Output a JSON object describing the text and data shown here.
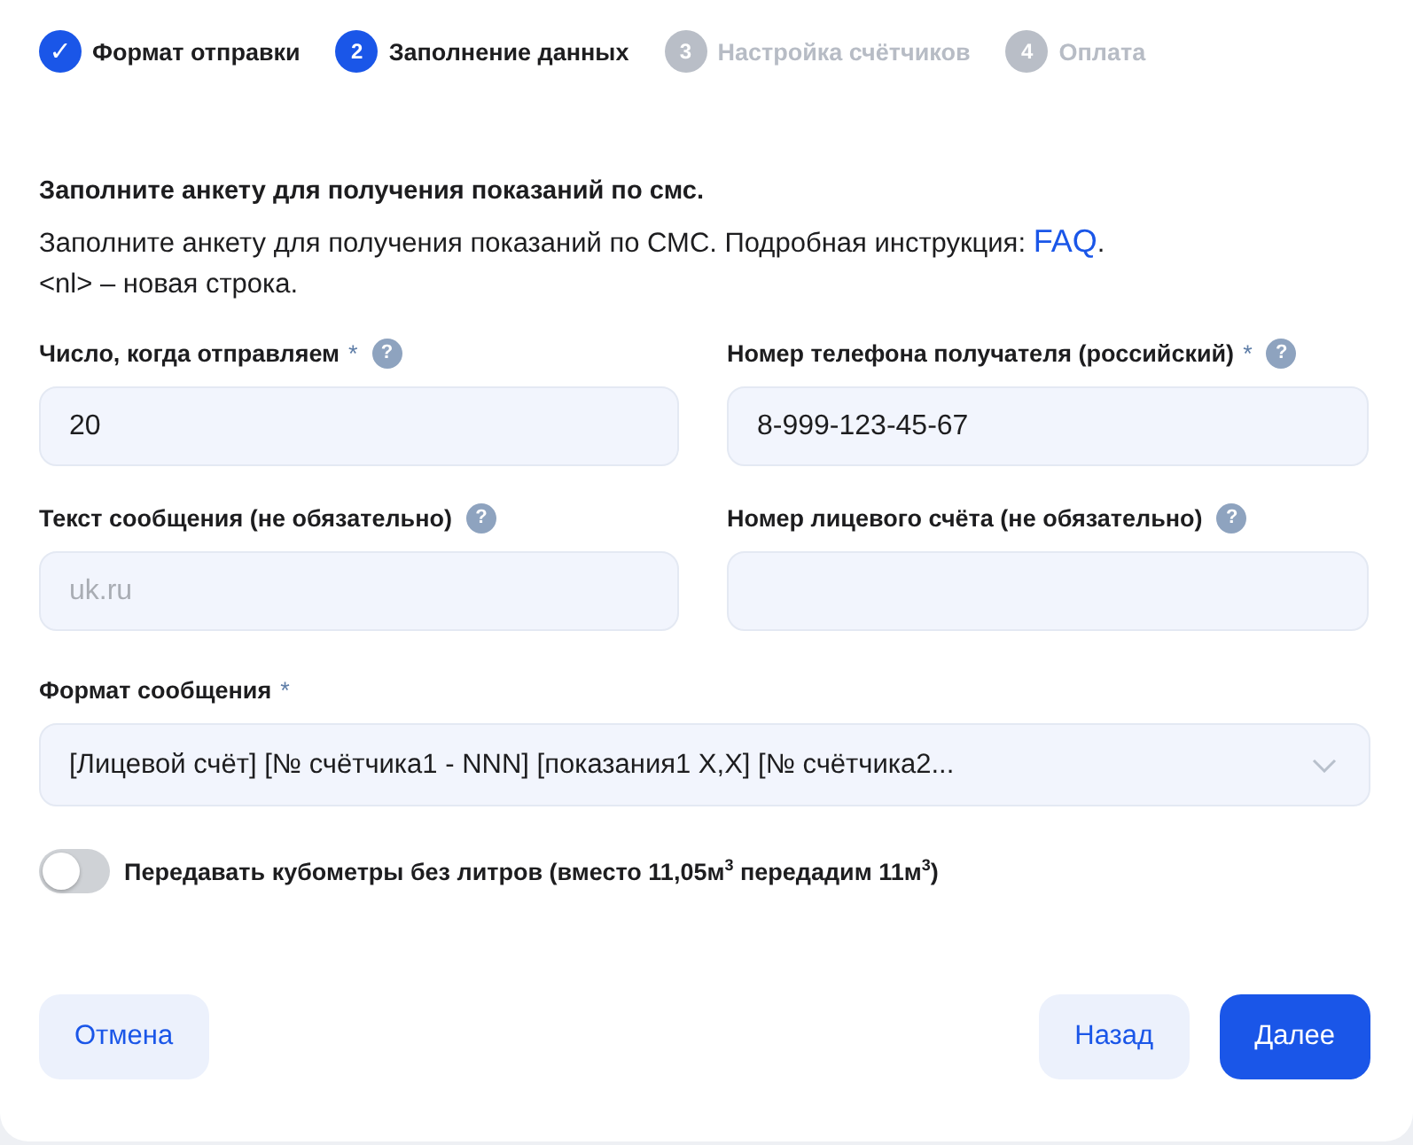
{
  "steps": [
    {
      "marker": "✓",
      "label": "Формат отправки",
      "kind": "done"
    },
    {
      "marker": "2",
      "label": "Заполнение данных",
      "kind": "current"
    },
    {
      "marker": "3",
      "label": "Настройка счётчиков",
      "kind": "upcoming"
    },
    {
      "marker": "4",
      "label": "Оплата",
      "kind": "upcoming"
    }
  ],
  "heading": "Заполните анкету для получения показаний по смс.",
  "description": {
    "before": "Заполните анкету для получения показаний по СМС. Подробная инструкция: ",
    "link": "FAQ",
    "after": ".",
    "second_line": "<nl> – новая строка."
  },
  "fields": [
    {
      "label": "Число, когда отправляем",
      "required_mark": "*",
      "help": "?",
      "value": "20"
    },
    {
      "label": "Номер телефона получателя (российский)",
      "required_mark": "*",
      "help": "?",
      "value": "8-999-123-45-67"
    },
    {
      "label": "Текст сообщения (не обязательно)",
      "help": "?",
      "placeholder": "uk.ru"
    },
    {
      "label": "Номер лицевого счёта (не обязательно)",
      "help": "?"
    }
  ],
  "format_select": {
    "label": "Формат сообщения",
    "required_mark": "*",
    "value": "[Лицевой счёт] [№ счётчика1 - NNN] [показания1 X,X] [№ счётчика2..."
  },
  "toggle": {
    "label": "Передавать кубометры без литров (вместо 11,05м$^{3}$ передадим 11м$^{3}$)",
    "on": false
  },
  "buttons": [
    {
      "label": "Отмена",
      "kind": "secondary"
    },
    {
      "label": "Назад",
      "kind": "secondary"
    },
    {
      "label": "Далее",
      "kind": "primary"
    }
  ]
}
